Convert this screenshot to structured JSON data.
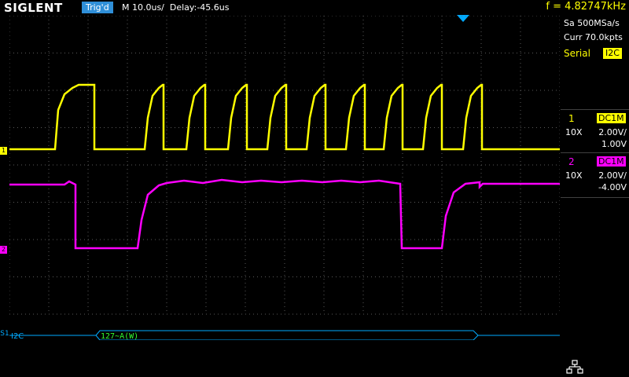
{
  "header": {
    "brand": "SIGLENT",
    "trigger_status": "Trig'd",
    "timebase": "M 10.0us/",
    "delay": "Delay:-45.6us",
    "frequency": "f = 4.82747kHz"
  },
  "acquisition": {
    "sample_rate": "Sa 500MSa/s",
    "memory_depth": "Curr 70.0kpts"
  },
  "serial": {
    "label": "Serial",
    "protocol": "I2C"
  },
  "channels": [
    {
      "number": "1",
      "coupling": "DC1M",
      "probe": "10X",
      "scale": "2.00V/",
      "offset": "1.00V",
      "color": "#ffff00",
      "marker": "1"
    },
    {
      "number": "2",
      "coupling": "DC1M",
      "probe": "10X",
      "scale": "2.00V/",
      "offset": "-4.00V",
      "color": "#ff00ff",
      "marker": "2"
    }
  ],
  "decode": {
    "marker": "S1",
    "protocol": "I2C",
    "packet": "127~A(W)",
    "color": "#00aaff",
    "text_color": "#33ff33"
  },
  "icons": {
    "network": "network-icon",
    "trigger_position": "trigger-position-marker"
  },
  "colors": {
    "grid": "#5a5a5a",
    "ch1": "#ffff00",
    "ch2": "#ff00ff",
    "trigger": "#2f8fd8"
  }
}
